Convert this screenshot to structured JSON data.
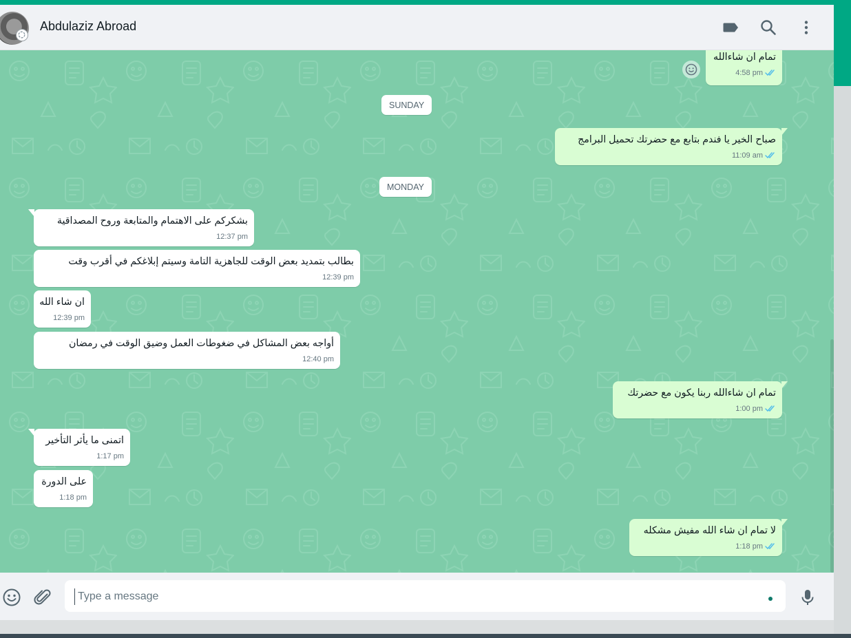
{
  "header": {
    "contact_name": "Abdulaziz Abroad"
  },
  "composer": {
    "placeholder": "Type a message"
  },
  "day_separators": [
    "SUNDAY",
    "MONDAY"
  ],
  "messages": [
    {
      "dir": "out",
      "text": "تمام ان شاءالله",
      "time": "4:58 pm"
    },
    {
      "dir": "out",
      "text": "صباح الخير يا فندم بتابع مع حضرتك تحميل البرامج",
      "time": "11:09 am"
    },
    {
      "dir": "in",
      "text": "بشكركم على الاهتمام والمتابعة وروح المصداقية",
      "time": "12:37 pm"
    },
    {
      "dir": "in",
      "text": "بطالب بتمديد بعض الوقت للجاهزية التامة وسيتم إبلاغكم في أقرب وقت",
      "time": "12:39 pm"
    },
    {
      "dir": "in",
      "text": "ان شاء الله",
      "time": "12:39 pm"
    },
    {
      "dir": "in",
      "text": "أواجه بعض المشاكل في ضغوطات العمل وضيق الوقت في رمضان",
      "time": "12:40 pm"
    },
    {
      "dir": "out",
      "text": "تمام ان شاءالله ربنا يكون مع حضرتك",
      "time": "1:00 pm"
    },
    {
      "dir": "in",
      "text": "اتمنى ما يأثر التأخير",
      "time": "1:17 pm"
    },
    {
      "dir": "in",
      "text": "على الدورة",
      "time": "1:18 pm"
    },
    {
      "dir": "out",
      "text": "لا تمام ان شاء الله مفيش مشكله",
      "time": "1:18 pm"
    }
  ],
  "icons": {
    "labels": "label-icon",
    "search": "search-icon",
    "menu": "menu-icon",
    "emoji": "emoji-icon",
    "attach": "attach-icon",
    "mic": "mic-icon",
    "react": "react-emoji-icon",
    "read_receipt": "double-check-icon",
    "status": "status-ring-icon"
  },
  "colors": {
    "accent": "#00a884",
    "chat_background": "#7ecca9",
    "incoming_bubble": "#ffffff",
    "outgoing_bubble": "#d9fdd3",
    "read_tick": "#53bdeb"
  }
}
